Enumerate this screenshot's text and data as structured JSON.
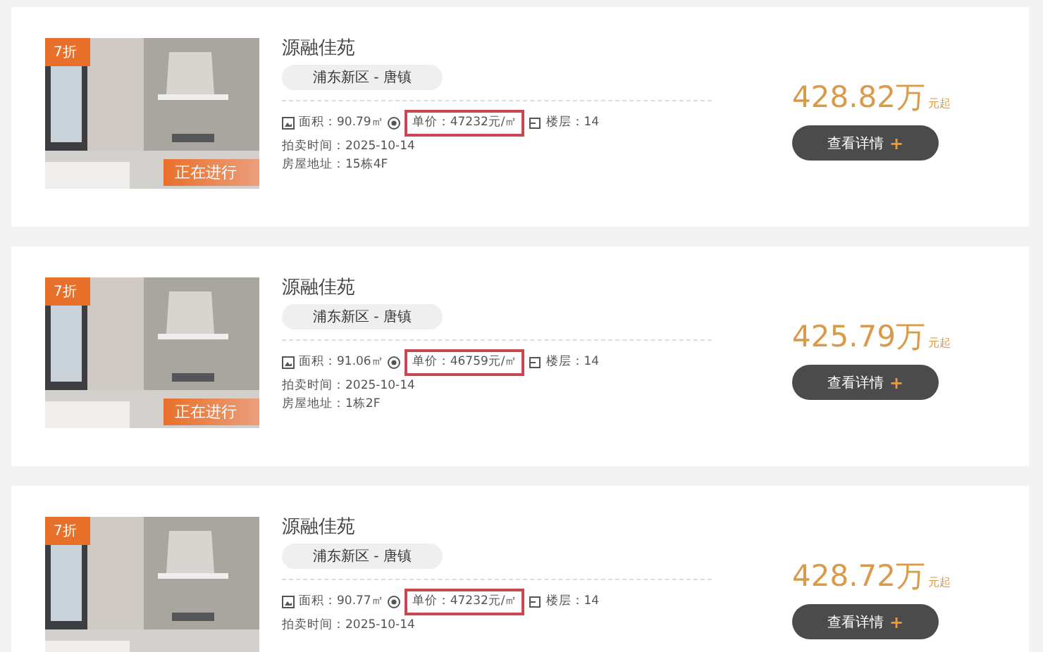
{
  "listings": [
    {
      "badge": "7折",
      "status": "正在进行",
      "title": "源融佳苑",
      "district": "浦东新区 - 唐镇",
      "area": "面积：90.79㎡",
      "unit_price": "单价：47232元/㎡",
      "unit_price_highlighted": true,
      "floor": "楼层：14",
      "auction_date": "拍卖时间：2025-10-14",
      "address": "房屋地址：15栋4F",
      "price": "428.82万",
      "price_suffix": "元起",
      "button": "查看详情",
      "button_icon": "+"
    },
    {
      "badge": "7折",
      "status": "正在进行",
      "title": "源融佳苑",
      "district": "浦东新区 - 唐镇",
      "area": "面积：91.06㎡",
      "unit_price": "单价：46759元/㎡",
      "unit_price_highlighted": true,
      "floor": "楼层：14",
      "auction_date": "拍卖时间：2025-10-14",
      "address": "房屋地址：1栋2F",
      "price": "425.79万",
      "price_suffix": "元起",
      "button": "查看详情",
      "button_icon": "+"
    },
    {
      "badge": "7折",
      "title": "源融佳苑",
      "district": "浦东新区 - 唐镇",
      "area": "面积：90.77㎡",
      "unit_price": "单价：47232元/㎡",
      "unit_price_highlighted": true,
      "floor": "楼层：14",
      "auction_date": "拍卖时间：2025-10-14",
      "price": "428.72万",
      "price_suffix": "元起",
      "button": "查看详情",
      "button_icon": "+"
    }
  ]
}
